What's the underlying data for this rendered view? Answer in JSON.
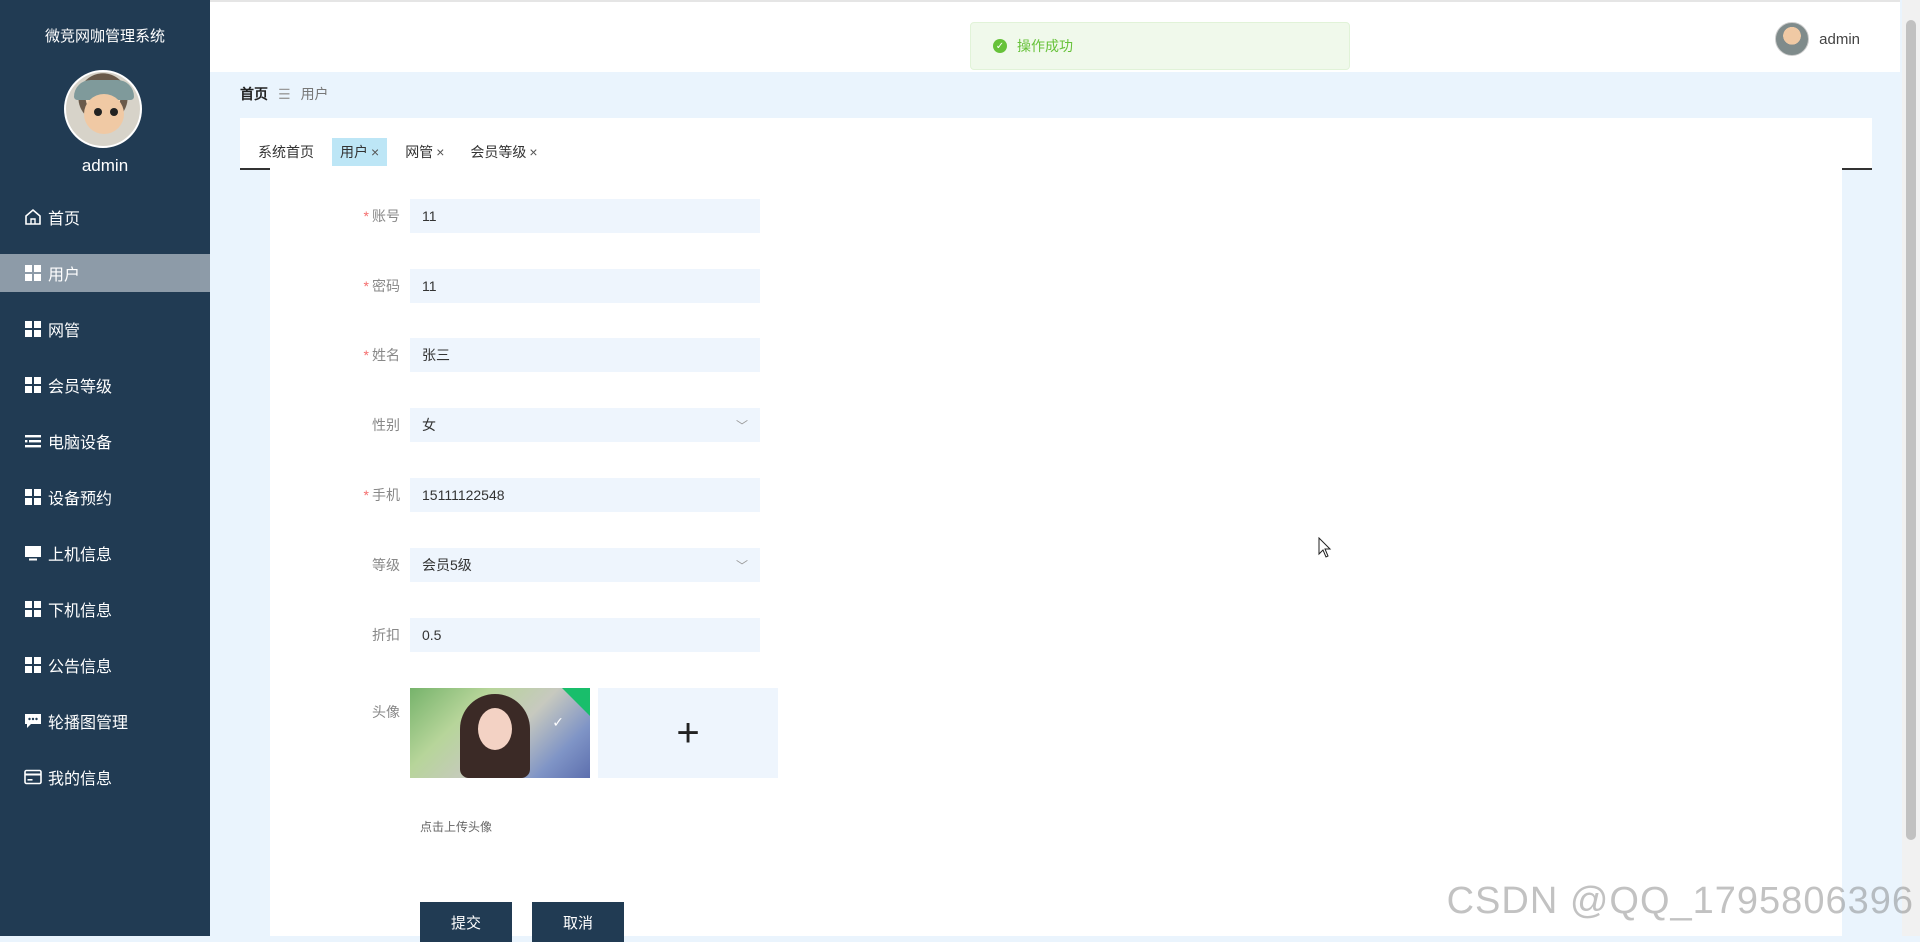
{
  "sidebar": {
    "title": "微竞网咖管理系统",
    "username": "admin",
    "items": [
      {
        "label": "首页",
        "icon": "home-icon",
        "active": false
      },
      {
        "label": "用户",
        "icon": "grid-icon",
        "active": true
      },
      {
        "label": "网管",
        "icon": "grid-icon",
        "active": false
      },
      {
        "label": "会员等级",
        "icon": "grid-icon",
        "active": false
      },
      {
        "label": "电脑设备",
        "icon": "list-icon",
        "active": false
      },
      {
        "label": "设备预约",
        "icon": "grid-icon",
        "active": false
      },
      {
        "label": "上机信息",
        "icon": "monitor-icon",
        "active": false
      },
      {
        "label": "下机信息",
        "icon": "grid-icon",
        "active": false
      },
      {
        "label": "公告信息",
        "icon": "grid-icon",
        "active": false
      },
      {
        "label": "轮播图管理",
        "icon": "chat-icon",
        "active": false
      },
      {
        "label": "我的信息",
        "icon": "card-icon",
        "active": false
      }
    ]
  },
  "topbar": {
    "toast": "操作成功",
    "username": "admin"
  },
  "breadcrumb": {
    "home": "首页",
    "separator": "☰",
    "current": "用户"
  },
  "tabs": [
    {
      "label": "系统首页",
      "closable": false,
      "active": false
    },
    {
      "label": "用户",
      "closable": true,
      "active": true
    },
    {
      "label": "网管",
      "closable": true,
      "active": false
    },
    {
      "label": "会员等级",
      "closable": true,
      "active": false
    }
  ],
  "form": {
    "account": {
      "label": "账号",
      "value": "11",
      "required": true
    },
    "password": {
      "label": "密码",
      "value": "11",
      "required": true
    },
    "name": {
      "label": "姓名",
      "value": "张三",
      "required": true
    },
    "gender": {
      "label": "性别",
      "value": "女",
      "required": false
    },
    "phone": {
      "label": "手机",
      "value": "15111122548",
      "required": true
    },
    "level": {
      "label": "等级",
      "value": "会员5级",
      "required": false
    },
    "discount": {
      "label": "折扣",
      "value": "0.5",
      "required": false
    },
    "avatar": {
      "label": "头像",
      "hint": "点击上传头像"
    },
    "submit": "提交",
    "cancel": "取消"
  },
  "watermark": "CSDN @QQ_1795806396",
  "colors": {
    "sidebar_bg": "#213b53",
    "active_item_bg": "#8d9ba8",
    "toast_green": "#67c23a",
    "input_bg": "#eef5fd",
    "required_red": "#f56c6c"
  }
}
